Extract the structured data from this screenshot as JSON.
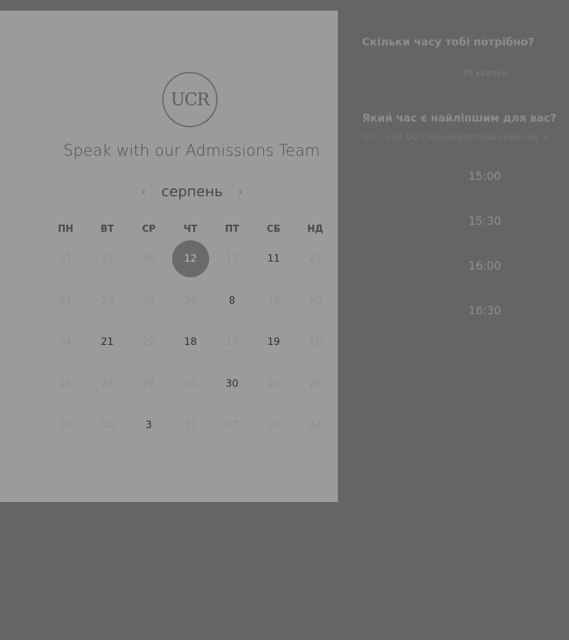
{
  "logo": {
    "text": "UCR"
  },
  "title": "Speak with our Admissions Team",
  "month": {
    "label": "серпень",
    "prev_icon": "chevron-left-icon",
    "next_icon": "chevron-right-icon"
  },
  "weekdays": [
    "ПН",
    "ВТ",
    "СР",
    "ЧТ",
    "ПТ",
    "СБ",
    "НД"
  ],
  "days": [
    {
      "label": "31",
      "available": false
    },
    {
      "label": "11",
      "available": false
    },
    {
      "label": "30",
      "available": false
    },
    {
      "label": "12",
      "available": true,
      "selected": true
    },
    {
      "label": "13",
      "available": false
    },
    {
      "label": "11",
      "available": true
    },
    {
      "label": "21",
      "available": false
    },
    {
      "label": "27",
      "available": false
    },
    {
      "label": "20",
      "available": false
    },
    {
      "label": "03",
      "available": false
    },
    {
      "label": "30",
      "available": false
    },
    {
      "label": "8",
      "available": true
    },
    {
      "label": "14",
      "available": false
    },
    {
      "label": "30",
      "available": false
    },
    {
      "label": "24",
      "available": false
    },
    {
      "label": "21",
      "available": true
    },
    {
      "label": "22",
      "available": false
    },
    {
      "label": "18",
      "available": true
    },
    {
      "label": "17",
      "available": false
    },
    {
      "label": "19",
      "available": true
    },
    {
      "label": "18",
      "available": false
    },
    {
      "label": "18",
      "available": false
    },
    {
      "label": "24",
      "available": false
    },
    {
      "label": "25",
      "available": false
    },
    {
      "label": "20",
      "available": false
    },
    {
      "label": "30",
      "available": true
    },
    {
      "label": "22",
      "available": false
    },
    {
      "label": "20",
      "available": false
    },
    {
      "label": "29",
      "available": false
    },
    {
      "label": "10",
      "available": false
    },
    {
      "label": "3",
      "available": true
    },
    {
      "label": "21",
      "available": false
    },
    {
      "label": "02",
      "available": false
    },
    {
      "label": "20",
      "available": false
    },
    {
      "label": "04",
      "available": false
    }
  ],
  "right": {
    "duration_question": "Скільки часу тобі потрібно?",
    "duration_value": "30 хвилин",
    "time_question": "Який час є найліпшим для вас?",
    "timezone": "UTC +03:00 Східноєвропейський час",
    "slots": [
      "15:00",
      "15:30",
      "16:00",
      "16:30"
    ]
  },
  "colors": {
    "background": "#656565",
    "panel": "#9b9b9b",
    "selected": "#6a6a6a"
  }
}
